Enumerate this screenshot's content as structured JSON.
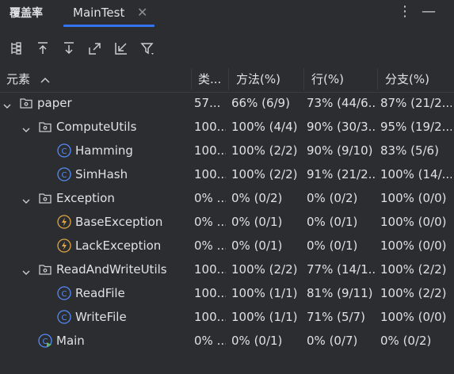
{
  "window": {
    "tool_title": "覆盖率",
    "tab_label": "MainTest",
    "tab_close_icon": "close-icon",
    "more_icon": "more-vertical-icon",
    "minimize_icon": "minimize-icon"
  },
  "toolbar": {
    "icons": [
      "flatten-packages-icon",
      "navigate-up-icon",
      "navigate-down-icon",
      "export-icon",
      "import-icon",
      "filter-icon"
    ]
  },
  "table": {
    "headers": {
      "element": "元素",
      "class": "类...",
      "method": "方法(%)",
      "line": "行(%)",
      "branch": "分支(%)"
    },
    "sort_icon": "sort-ascending-icon",
    "rows": [
      {
        "name": "paper",
        "kind": "package",
        "class": "57...",
        "method": "66% (6/9)",
        "line": "73% (44/6...",
        "branch": "87% (21/2..."
      },
      {
        "name": "ComputeUtils",
        "kind": "package",
        "class": "100...",
        "method": "100% (4/4)",
        "line": "90% (30/3...",
        "branch": "95% (19/2..."
      },
      {
        "name": "Hamming",
        "kind": "class",
        "class": "100...",
        "method": "100% (2/2)",
        "line": "90% (9/10)",
        "branch": "83% (5/6)"
      },
      {
        "name": "SimHash",
        "kind": "class",
        "class": "100...",
        "method": "100% (2/2)",
        "line": "91% (21/2...",
        "branch": "100% (14/..."
      },
      {
        "name": "Exception",
        "kind": "package",
        "class": "0% ...",
        "method": "0% (0/2)",
        "line": "0% (0/2)",
        "branch": "100% (0/0)"
      },
      {
        "name": "BaseException",
        "kind": "exception",
        "class": "0% ...",
        "method": "0% (0/1)",
        "line": "0% (0/1)",
        "branch": "100% (0/0)"
      },
      {
        "name": "LackException",
        "kind": "exception",
        "class": "0% ...",
        "method": "0% (0/1)",
        "line": "0% (0/1)",
        "branch": "100% (0/0)"
      },
      {
        "name": "ReadAndWriteUtils",
        "kind": "package",
        "class": "100...",
        "method": "100% (2/2)",
        "line": "77% (14/1...",
        "branch": "100% (2/2)"
      },
      {
        "name": "ReadFile",
        "kind": "class",
        "class": "100...",
        "method": "100% (1/1)",
        "line": "81% (9/11)",
        "branch": "100% (2/2)"
      },
      {
        "name": "WriteFile",
        "kind": "class",
        "class": "100...",
        "method": "100% (1/1)",
        "line": "71% (5/7)",
        "branch": "100% (0/0)"
      },
      {
        "name": "Main",
        "kind": "runnable-class",
        "class": "0% ...",
        "method": "0% (0/1)",
        "line": "0% (0/7)",
        "branch": "0% (0/2)"
      }
    ]
  },
  "colors": {
    "background": "#2b2d30",
    "accent": "#3574f0",
    "class_icon": "#548af7",
    "exception_icon": "#e0a640",
    "run_badge": "#5fb865"
  }
}
